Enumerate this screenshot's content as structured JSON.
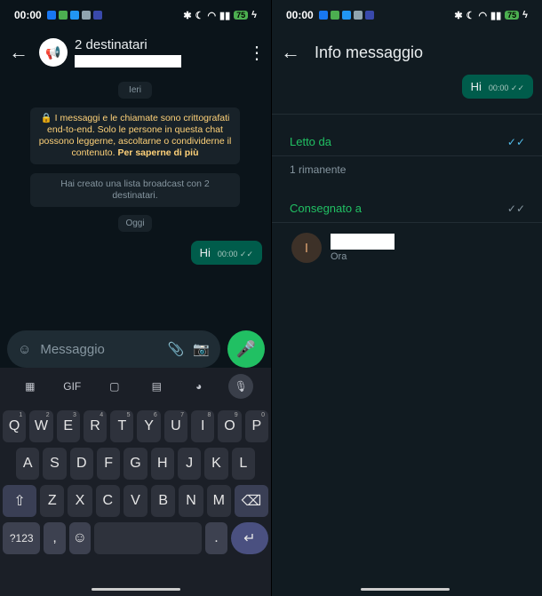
{
  "status": {
    "time": "00:00",
    "battery": "75",
    "icons": [
      "facebook-icon",
      "app-icon",
      "app-icon",
      "mail-icon",
      "app-icon",
      "dot-icon"
    ]
  },
  "left": {
    "title": "2 destinatari",
    "date_yesterday": "Ieri",
    "encryption_notice": "I messaggi e le chiamate sono crittografati end-to-end. Solo le persone in questa chat possono leggerne, ascoltarne o condividerne il contenuto.",
    "encryption_link": "Per saperne di più",
    "broadcast_info": "Hai creato una lista broadcast con 2 destinatari.",
    "date_today": "Oggi",
    "message": {
      "text": "Hi",
      "time": "00:00"
    },
    "composer_placeholder": "Messaggio"
  },
  "keyboard": {
    "toolbar": [
      "grid-icon",
      "GIF",
      "sticker-icon",
      "clipboard-icon",
      "palette-icon",
      "mic-icon"
    ],
    "gif_label": "GIF",
    "row1": [
      "Q",
      "W",
      "E",
      "R",
      "T",
      "Y",
      "U",
      "I",
      "O",
      "P"
    ],
    "row1_nums": [
      "1",
      "2",
      "3",
      "4",
      "5",
      "6",
      "7",
      "8",
      "9",
      "0"
    ],
    "row2": [
      "A",
      "S",
      "D",
      "F",
      "G",
      "H",
      "J",
      "K",
      "L"
    ],
    "row3": [
      "Z",
      "X",
      "C",
      "V",
      "B",
      "N",
      "M"
    ],
    "symbols": "?123",
    "comma": ",",
    "period": "."
  },
  "right": {
    "title": "Info messaggio",
    "message": {
      "text": "Hi",
      "time": "00:00"
    },
    "read_by": "Letto da",
    "remaining": "1 rimanente",
    "delivered_to": "Consegnato a",
    "contact": {
      "initial": "I",
      "when": "Ora"
    }
  },
  "colors": {
    "accent": "#21c063",
    "bubble": "#005c4b",
    "read_tick": "#53bdeb",
    "notice": "#ffd279"
  }
}
